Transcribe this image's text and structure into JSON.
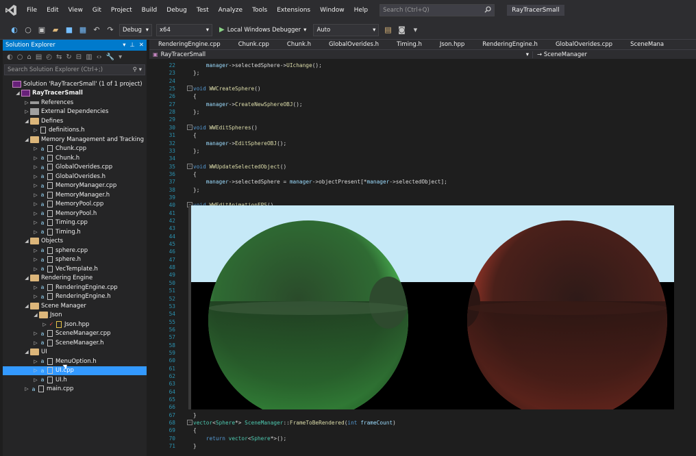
{
  "window": {
    "title": "RayTracerSmall"
  },
  "menu": [
    "File",
    "Edit",
    "View",
    "Git",
    "Project",
    "Build",
    "Debug",
    "Test",
    "Analyze",
    "Tools",
    "Extensions",
    "Window",
    "Help"
  ],
  "search": {
    "placeholder": "Search (Ctrl+Q)"
  },
  "toolbar": {
    "config": "Debug",
    "platform": "x64",
    "run_label": "Local Windows Debugger",
    "run_mode": "Auto"
  },
  "solution_explorer": {
    "title": "Solution Explorer",
    "search_placeholder": "Search Solution Explorer (Ctrl+;)",
    "items": [
      {
        "label": "Solution 'RayTracerSmall' (1 of 1 project)",
        "depth": 0,
        "icon": "solution"
      },
      {
        "label": "RayTracerSmall",
        "depth": 1,
        "icon": "project",
        "expanded": true,
        "bold": true
      },
      {
        "label": "References",
        "depth": 2,
        "icon": "references",
        "expanded": false
      },
      {
        "label": "External Dependencies",
        "depth": 2,
        "icon": "external",
        "expanded": false
      },
      {
        "label": "Defines",
        "depth": 2,
        "icon": "folder",
        "expanded": true
      },
      {
        "label": "definitions.h",
        "depth": 3,
        "icon": "file-h",
        "expanded": false
      },
      {
        "label": "Memory Management and Tracking",
        "depth": 2,
        "icon": "folder",
        "expanded": true
      },
      {
        "label": "Chunk.cpp",
        "depth": 3,
        "icon": "file-cpp",
        "lock": true
      },
      {
        "label": "Chunk.h",
        "depth": 3,
        "icon": "file-h",
        "lock": true
      },
      {
        "label": "GlobalOverides.cpp",
        "depth": 3,
        "icon": "file-cpp",
        "lock": true
      },
      {
        "label": "GlobalOverides.h",
        "depth": 3,
        "icon": "file-h",
        "lock": true
      },
      {
        "label": "MemoryManager.cpp",
        "depth": 3,
        "icon": "file-cpp",
        "lock": true
      },
      {
        "label": "MemoryManager.h",
        "depth": 3,
        "icon": "file-h",
        "lock": true
      },
      {
        "label": "MemoryPool.cpp",
        "depth": 3,
        "icon": "file-cpp",
        "lock": true
      },
      {
        "label": "MemoryPool.h",
        "depth": 3,
        "icon": "file-h",
        "lock": true
      },
      {
        "label": "Timing.cpp",
        "depth": 3,
        "icon": "file-cpp",
        "lock": true
      },
      {
        "label": "Timing.h",
        "depth": 3,
        "icon": "file-h",
        "lock": true
      },
      {
        "label": "Objects",
        "depth": 2,
        "icon": "folder",
        "expanded": true
      },
      {
        "label": "sphere.cpp",
        "depth": 3,
        "icon": "file-cpp",
        "lock": true
      },
      {
        "label": "sphere.h",
        "depth": 3,
        "icon": "file-h",
        "lock": true
      },
      {
        "label": "VecTemplate.h",
        "depth": 3,
        "icon": "file-h",
        "lock": true
      },
      {
        "label": "Rendering Engine",
        "depth": 2,
        "icon": "folder",
        "expanded": true
      },
      {
        "label": "RenderingEngine.cpp",
        "depth": 3,
        "icon": "file-cpp",
        "lock": true
      },
      {
        "label": "RenderingEngine.h",
        "depth": 3,
        "icon": "file-h",
        "lock": true
      },
      {
        "label": "Scene Manager",
        "depth": 2,
        "icon": "folder",
        "expanded": true
      },
      {
        "label": "Json",
        "depth": 3,
        "icon": "folder",
        "expanded": true
      },
      {
        "label": "Json.hpp",
        "depth": 4,
        "icon": "file-json",
        "check": true
      },
      {
        "label": "SceneManager.cpp",
        "depth": 3,
        "icon": "file-cpp",
        "lock": true
      },
      {
        "label": "SceneManager.h",
        "depth": 3,
        "icon": "file-h",
        "lock": true
      },
      {
        "label": "UI",
        "depth": 2,
        "icon": "folder",
        "expanded": true
      },
      {
        "label": "MenuOption.h",
        "depth": 3,
        "icon": "file-h",
        "lock": true
      },
      {
        "label": "UI.cpp",
        "depth": 3,
        "icon": "file-cpp",
        "lock": true,
        "selected": true
      },
      {
        "label": "UI.h",
        "depth": 3,
        "icon": "file-h",
        "lock": true
      },
      {
        "label": "main.cpp",
        "depth": 2,
        "icon": "file-cpp",
        "lock": true
      }
    ]
  },
  "editor": {
    "tabs": [
      "RenderingEngine.cpp",
      "Chunk.cpp",
      "Chunk.h",
      "GlobalOverides.h",
      "Timing.h",
      "Json.hpp",
      "RenderingEngine.h",
      "GlobalOverides.cpp",
      "SceneMana"
    ],
    "nav_project": "RayTracerSmall",
    "nav_scope": "SceneManager",
    "lines": [
      {
        "n": "22",
        "text": "    manager->selectedSphere->UIchange();"
      },
      {
        "n": "23",
        "text": "};"
      },
      {
        "n": "24",
        "text": ""
      },
      {
        "n": "25",
        "text": "void WWCreateSphere()",
        "fold": true
      },
      {
        "n": "26",
        "text": "{"
      },
      {
        "n": "27",
        "text": "    manager->CreateNewSphereOBJ();"
      },
      {
        "n": "28",
        "text": "};"
      },
      {
        "n": "29",
        "text": ""
      },
      {
        "n": "30",
        "text": "void WWEditSpheres()",
        "fold": true
      },
      {
        "n": "31",
        "text": "{"
      },
      {
        "n": "32",
        "text": "    manager->EditSphereOBJ();"
      },
      {
        "n": "33",
        "text": "};"
      },
      {
        "n": "34",
        "text": ""
      },
      {
        "n": "35",
        "text": "void WWUpdateSelectedObject()",
        "fold": true
      },
      {
        "n": "36",
        "text": "{"
      },
      {
        "n": "37",
        "text": "    manager->selectedSphere = manager->objectPresent[*manager->selectedObject];"
      },
      {
        "n": "38",
        "text": "};"
      },
      {
        "n": "39",
        "text": ""
      },
      {
        "n": "40",
        "text": "void WWEditAnimationFPS()",
        "fold": true
      },
      {
        "n": "41",
        "text": ""
      },
      {
        "n": "42",
        "text": ""
      },
      {
        "n": "43",
        "text": ""
      },
      {
        "n": "44",
        "text": ""
      },
      {
        "n": "45",
        "text": ""
      },
      {
        "n": "46",
        "text": ""
      },
      {
        "n": "47",
        "text": ""
      },
      {
        "n": "48",
        "text": ""
      },
      {
        "n": "49",
        "text": ""
      },
      {
        "n": "50",
        "text": ""
      },
      {
        "n": "51",
        "text": ""
      },
      {
        "n": "52",
        "text": ""
      },
      {
        "n": "53",
        "text": ""
      },
      {
        "n": "54",
        "text": ""
      },
      {
        "n": "55",
        "text": ""
      },
      {
        "n": "56",
        "text": ""
      },
      {
        "n": "57",
        "text": ""
      },
      {
        "n": "58",
        "text": ""
      },
      {
        "n": "59",
        "text": ""
      },
      {
        "n": "60",
        "text": ""
      },
      {
        "n": "61",
        "text": ""
      },
      {
        "n": "62",
        "text": ""
      },
      {
        "n": "63",
        "text": ""
      },
      {
        "n": "64",
        "text": ""
      },
      {
        "n": "65",
        "text": ""
      },
      {
        "n": "66",
        "text": ""
      },
      {
        "n": "67",
        "text": "}"
      },
      {
        "n": "68",
        "text": "vector<Sphere*> SceneManager::FrameToBeRendered(int frameCount)",
        "fold": true
      },
      {
        "n": "69",
        "text": "{"
      },
      {
        "n": "70",
        "text": "    return vector<Sphere*>();"
      },
      {
        "n": "71",
        "text": "}"
      }
    ]
  },
  "render_window": {
    "sky_color": "#c6e9f7",
    "floor_color": "#000000",
    "spheres": [
      {
        "color": "green"
      },
      {
        "color": "red"
      }
    ]
  }
}
